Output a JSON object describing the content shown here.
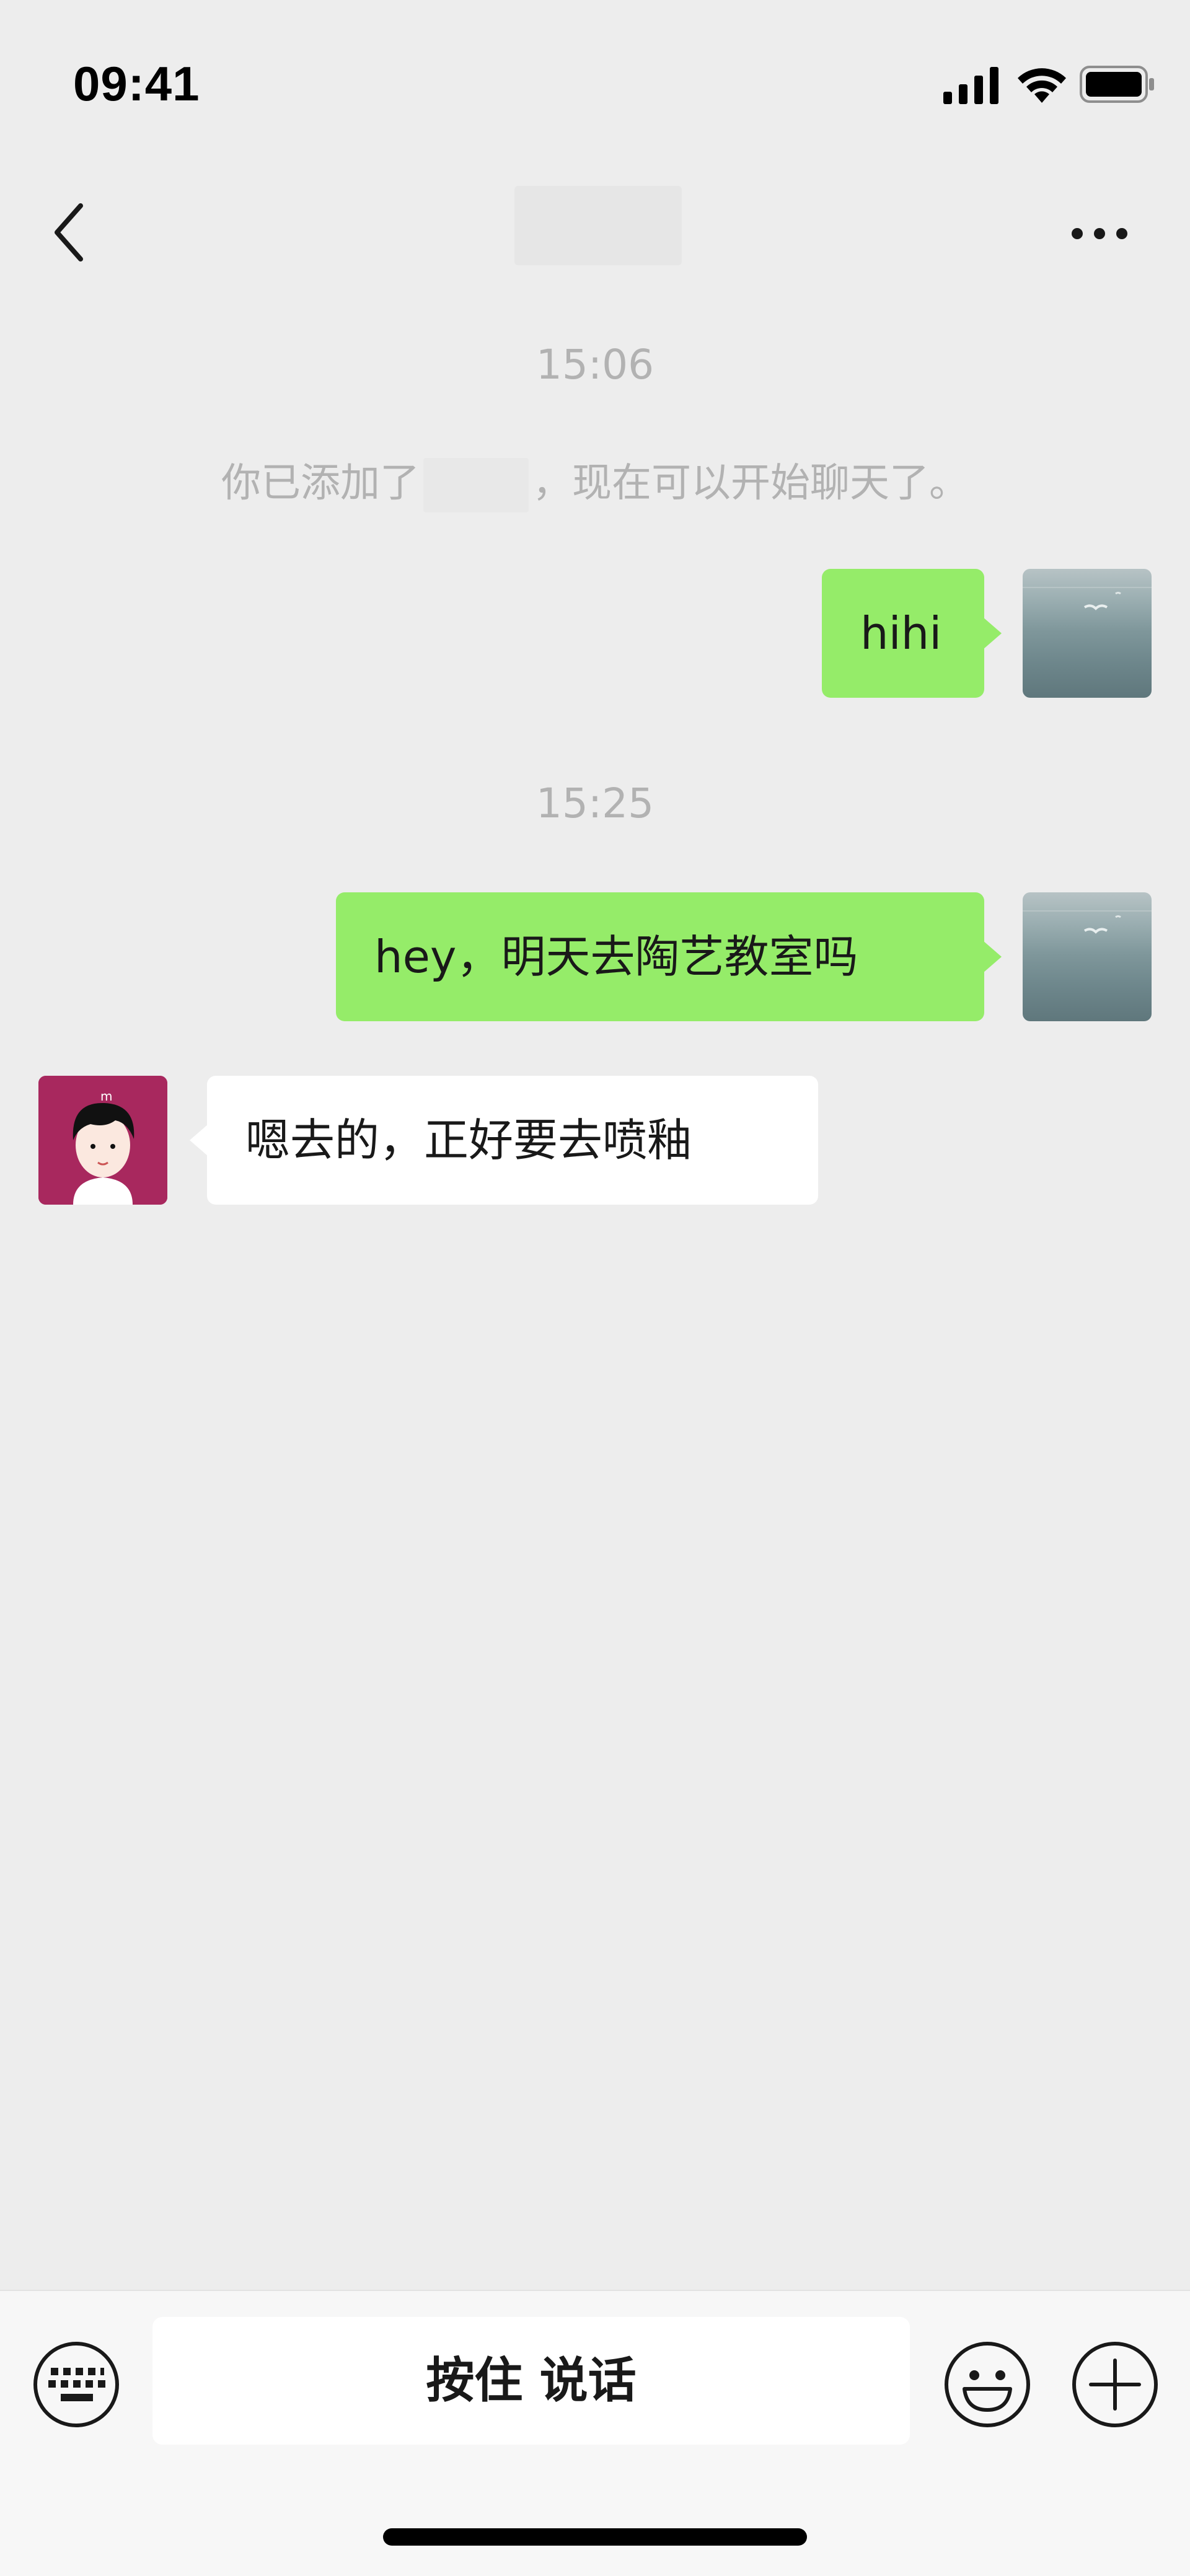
{
  "status_bar": {
    "time": "09:41"
  },
  "nav": {
    "title": ""
  },
  "messages": [
    {
      "type": "timestamp",
      "text": "15:06"
    },
    {
      "type": "system",
      "text_before": "你已添加了",
      "text_after": "，现在可以开始聊天了。"
    },
    {
      "type": "outgoing",
      "text": "hihi"
    },
    {
      "type": "timestamp",
      "text": "15:25"
    },
    {
      "type": "outgoing",
      "text": "hey，明天去陶艺教室吗"
    },
    {
      "type": "incoming",
      "text": "嗯去的，正好要去喷釉"
    }
  ],
  "input_bar": {
    "hold_to_talk_label": "按住 说话"
  },
  "colors": {
    "background": "#ededed",
    "outgoing_bubble": "#95ec69",
    "incoming_bubble": "#ffffff",
    "timestamp_text": "#b2b2b2",
    "avatar_contact_bg": "#a8285e"
  },
  "icons": [
    "signal-icon",
    "wifi-icon",
    "battery-icon",
    "back-icon",
    "more-icon",
    "keyboard-icon",
    "emoji-icon",
    "plus-icon"
  ]
}
